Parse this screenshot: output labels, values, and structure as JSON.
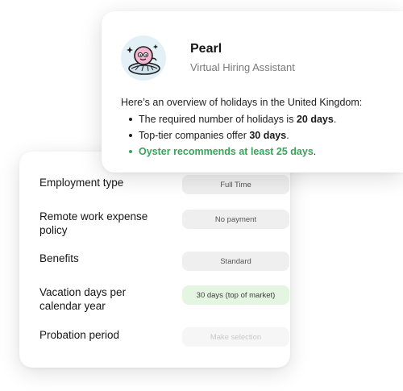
{
  "colors": {
    "accent_green": "#3aa45a",
    "highlight_pill_bg": "#e4f6e1",
    "avatar_bg": "#e3f1f7"
  },
  "assistant": {
    "name": "Pearl",
    "role": "Virtual Hiring Assistant",
    "avatar_icon": "pearl-mascot-icon",
    "intro": "Here’s an overview of holidays in the United Kingdom:",
    "bullets": [
      {
        "prefix": "The required number of holidays is ",
        "bold": "20 days",
        "suffix": "."
      },
      {
        "prefix": "Top-tier companies offer ",
        "bold": "30 days",
        "suffix": "."
      },
      {
        "prefix": "Oyster recommends at least 25 days",
        "bold": "",
        "suffix": "."
      }
    ]
  },
  "form": {
    "rows": [
      {
        "label": "Employment type",
        "value": "Full Time"
      },
      {
        "label": "Remote work expense policy",
        "value": "No payment"
      },
      {
        "label": "Benefits",
        "value": "Standard"
      },
      {
        "label": "Vacation days per calendar year",
        "value": "30 days (top of market)"
      },
      {
        "label": "Probation period",
        "placeholder": "Make selection"
      }
    ]
  }
}
